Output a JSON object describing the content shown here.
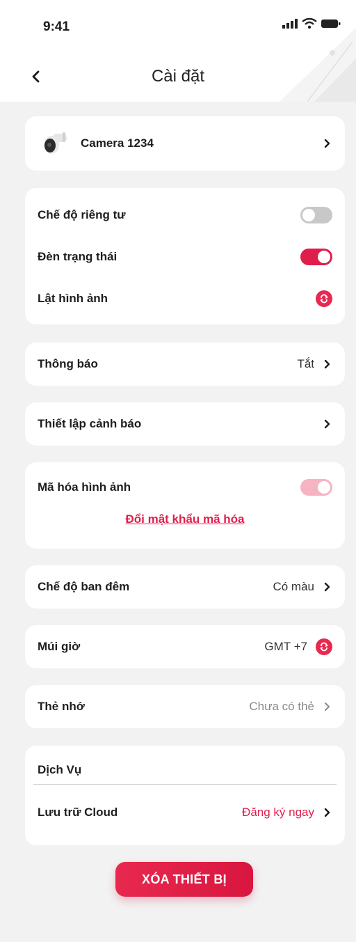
{
  "status_bar": {
    "time": "9:41"
  },
  "header": {
    "title": "Cài đặt"
  },
  "device": {
    "name": "Camera 1234"
  },
  "general": {
    "privacy_mode": {
      "label": "Chế độ riêng tư",
      "state": "off"
    },
    "status_light": {
      "label": "Đèn trạng thái",
      "state": "on"
    },
    "flip_image": {
      "label": "Lật hình ảnh"
    }
  },
  "notifications": {
    "label": "Thông báo",
    "value": "Tắt"
  },
  "alert_settings": {
    "label": "Thiết lập cảnh báo"
  },
  "encryption": {
    "label": "Mã hóa hình ảnh",
    "state": "on-disabled",
    "link": "Đổi mật khẩu mã hóa"
  },
  "night_mode": {
    "label": "Chế độ ban đêm",
    "value": "Có màu"
  },
  "timezone": {
    "label": "Múi giờ",
    "value": "GMT +7"
  },
  "memory_card": {
    "label": "Thẻ nhớ",
    "value": "Chưa có thẻ"
  },
  "services": {
    "title": "Dịch Vụ",
    "cloud_label": "Lưu trữ Cloud",
    "cloud_action": "Đăng ký ngay"
  },
  "delete_button": {
    "label": "XÓA THIẾT BỊ"
  },
  "colors": {
    "accent": "#e01e4c",
    "background": "#f2f2f2",
    "card": "#ffffff",
    "muted": "#8a8a8a"
  }
}
